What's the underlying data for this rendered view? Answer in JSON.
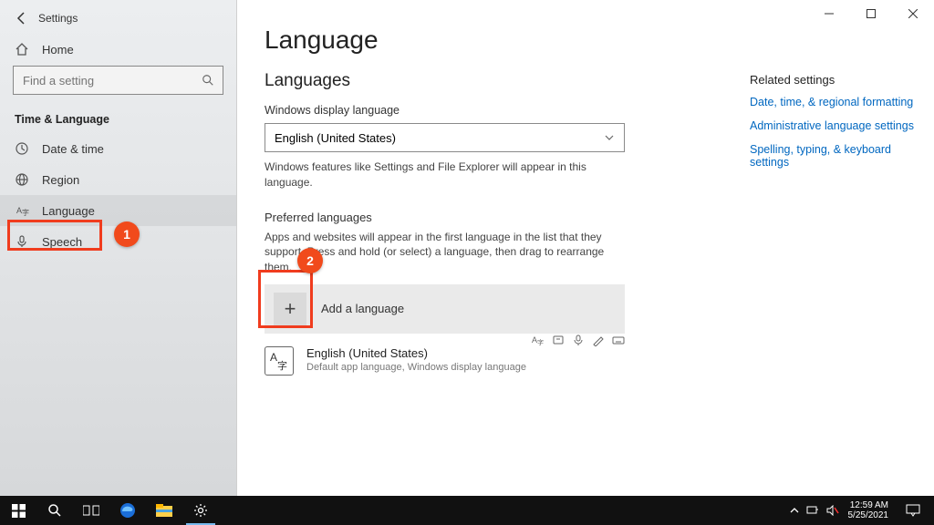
{
  "window": {
    "title": "Settings",
    "min_label": "Minimize",
    "max_label": "Maximize",
    "close_label": "Close"
  },
  "sidebar": {
    "home_label": "Home",
    "search_placeholder": "Find a setting",
    "category_label": "Time & Language",
    "items": [
      {
        "icon": "clock",
        "label": "Date & time"
      },
      {
        "icon": "globe",
        "label": "Region"
      },
      {
        "icon": "lang",
        "label": "Language",
        "active": true
      },
      {
        "icon": "mic",
        "label": "Speech"
      }
    ]
  },
  "callouts": {
    "one": "1",
    "two": "2"
  },
  "main": {
    "page_title": "Language",
    "languages_heading": "Languages",
    "display_lang_label": "Windows display language",
    "display_lang_value": "English (United States)",
    "display_lang_help": "Windows features like Settings and File Explorer will appear in this language.",
    "preferred_heading": "Preferred languages",
    "preferred_help": "Apps and websites will appear in the first language in the list that they support. Press and hold (or select) a language, then drag to rearrange them.",
    "add_language_label": "Add a language",
    "lang_entry": {
      "name": "English (United States)",
      "subtitle": "Default app language, Windows display language"
    }
  },
  "related": {
    "heading": "Related settings",
    "links": [
      "Date, time, & regional formatting",
      "Administrative language settings",
      "Spelling, typing, & keyboard settings"
    ]
  },
  "taskbar": {
    "time": "12:59 AM",
    "date": "5/25/2021"
  }
}
